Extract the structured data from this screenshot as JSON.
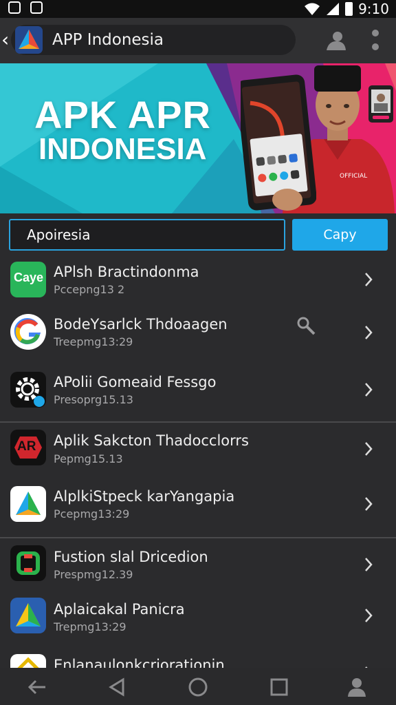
{
  "status_bar": {
    "time": "9:10"
  },
  "app_bar": {
    "title": "APP Indonesia"
  },
  "banner": {
    "line1": "APK APR",
    "line2": "INDONESIA",
    "phone_brand": "OFFICIAL"
  },
  "search": {
    "value": "Apoiresia",
    "button_label": "Capy"
  },
  "items": [
    {
      "title": "APlsh Bractindonma",
      "subtitle": "Pccepng13 2",
      "icon": "caye-logo-icon",
      "icon_text": "Caye"
    },
    {
      "title": "BodeYsarlck Thdoaagen",
      "subtitle": "Treepmg13:29",
      "icon": "google-g-icon"
    },
    {
      "title": "APolii Gomeaid Fessgo",
      "subtitle": "Presoprg15.13",
      "icon": "gear-icon"
    },
    {
      "title": "Aplik Sakcton Thadocclorrs",
      "subtitle": "Pepmg15.13",
      "icon": "ar-logo-icon",
      "icon_text": "AR"
    },
    {
      "title": "AlplkiStpeck karYangapia",
      "subtitle": "Pcepmg13:29",
      "icon": "triangle-logo-icon"
    },
    {
      "title": "Fustion slal Dricedion",
      "subtitle": "Prespmg12.39",
      "icon": "green-red-logo-icon"
    },
    {
      "title": "Aplaicakal Panicra",
      "subtitle": "Trepmg13:29",
      "icon": "drive-logo-icon"
    },
    {
      "title": "Enlanaulonkcriorationin",
      "subtitle": "",
      "icon": "yellow-diamond-icon"
    }
  ],
  "colors": {
    "accent": "#1fa7e8",
    "background": "#2b2b2d",
    "banner_teal": "#1fb9c9",
    "banner_pink": "#e8236a"
  }
}
